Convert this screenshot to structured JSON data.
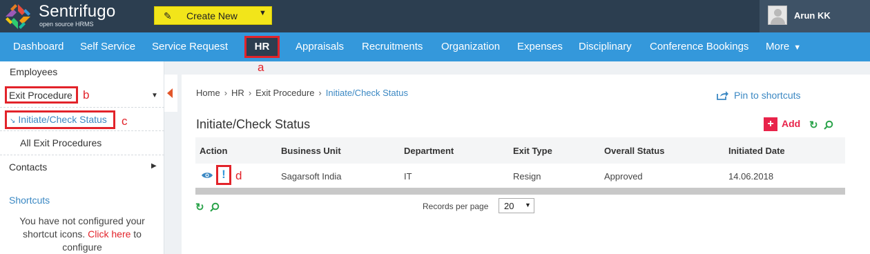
{
  "header": {
    "brand": "Sentrifugo",
    "brand_sub": "open source HRMS",
    "create_label": "Create New",
    "user_name": "Arun KK"
  },
  "nav": {
    "items": [
      "Dashboard",
      "Self Service",
      "Service Request",
      "HR",
      "Appraisals",
      "Recruitments",
      "Organization",
      "Expenses",
      "Disciplinary",
      "Conference Bookings",
      "More"
    ],
    "active": "HR"
  },
  "annotations": {
    "a": "a",
    "b": "b",
    "c": "c",
    "d": "d"
  },
  "sidebar": {
    "employees": "Employees",
    "exit_procedure": "Exit Procedure",
    "initiate_check": "Initiate/Check Status",
    "all_exit": "All Exit Procedures",
    "contacts": "Contacts",
    "shortcuts_title": "Shortcuts",
    "shortcuts_text1": "You have not configured your",
    "shortcuts_text2": "shortcut icons.",
    "shortcuts_link": "Click here",
    "shortcuts_text3": "to",
    "shortcuts_text4": "configure"
  },
  "breadcrumb": [
    "Home",
    "HR",
    "Exit Procedure",
    "Initiate/Check Status"
  ],
  "pin_label": "Pin to shortcuts",
  "page_title": "Initiate/Check Status",
  "add_label": "Add",
  "table": {
    "headers": [
      "Action",
      "Business Unit",
      "Department",
      "Exit Type",
      "Overall Status",
      "Initiated Date"
    ],
    "rows": [
      {
        "action_icon": "!",
        "business_unit": "Sagarsoft India",
        "department": "IT",
        "exit_type": "Resign",
        "status": "Approved",
        "date": "14.06.2018"
      }
    ]
  },
  "pagination": {
    "label": "Records per page",
    "value": "20"
  },
  "colors": {
    "topbar": "#2c3e50",
    "navbar": "#3498db",
    "create_btn": "#f2e51a",
    "annotation_red": "#e2232a",
    "add_pink": "#e8234a",
    "link_blue": "#3b88c3"
  },
  "icons": [
    "logo-icon",
    "pencil-icon",
    "chevron-down-icon",
    "avatar-icon",
    "pin-icon",
    "plus-icon",
    "refresh-icon",
    "search-icon",
    "eye-icon",
    "exclamation-icon",
    "arrow-icon",
    "caret-left-icon"
  ]
}
